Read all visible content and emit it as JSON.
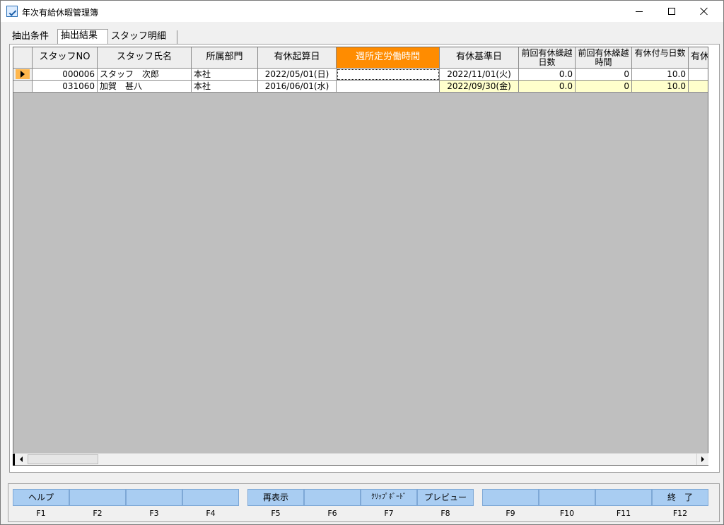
{
  "window": {
    "title": "年次有給休暇管理簿"
  },
  "tabs": [
    {
      "label": "抽出条件"
    },
    {
      "label": "抽出結果"
    },
    {
      "label": "スタッフ明細"
    }
  ],
  "grid": {
    "columns": [
      {
        "label": "スタッフNO"
      },
      {
        "label": "スタッフ氏名"
      },
      {
        "label": "所属部門"
      },
      {
        "label": "有休起算日"
      },
      {
        "label": "週所定労働時間"
      },
      {
        "label": "有休基準日"
      },
      {
        "label": "前回有休繰越日数"
      },
      {
        "label": "前回有休繰越時間"
      },
      {
        "label": "有休付与日数"
      },
      {
        "label": "有休"
      }
    ],
    "rows": [
      {
        "staff_no": "000006",
        "name": "スタッフ　次郎",
        "dept": "本社",
        "start_date": "2022/05/01(日)",
        "weekly_hours": "",
        "base_date": "2022/11/01(火)",
        "carry_days": "0.0",
        "carry_hours": "0",
        "grant_days": "10.0",
        "extra": ""
      },
      {
        "staff_no": "031060",
        "name": "加賀　甚八",
        "dept": "本社",
        "start_date": "2016/06/01(水)",
        "weekly_hours": "",
        "base_date": "2022/09/30(金)",
        "carry_days": "0.0",
        "carry_hours": "0",
        "grant_days": "10.0",
        "extra": ""
      }
    ]
  },
  "function_keys": [
    {
      "key": "F1",
      "label": "ヘルプ"
    },
    {
      "key": "F2",
      "label": ""
    },
    {
      "key": "F3",
      "label": ""
    },
    {
      "key": "F4",
      "label": ""
    },
    {
      "key": "F5",
      "label": "再表示"
    },
    {
      "key": "F6",
      "label": ""
    },
    {
      "key": "F7",
      "label": "ｸﾘｯﾌﾟﾎﾞｰﾄﾞ"
    },
    {
      "key": "F8",
      "label": "プレビュー"
    },
    {
      "key": "F9",
      "label": ""
    },
    {
      "key": "F10",
      "label": ""
    },
    {
      "key": "F11",
      "label": ""
    },
    {
      "key": "F12",
      "label": "終　了"
    }
  ],
  "colors": {
    "highlight_header": "#ff8c00",
    "row_cursor": "#ffb74d",
    "yellow_cell": "#ffffcc",
    "fkey": "#a9cdf2",
    "grid_bg": "#bfbfbf"
  }
}
